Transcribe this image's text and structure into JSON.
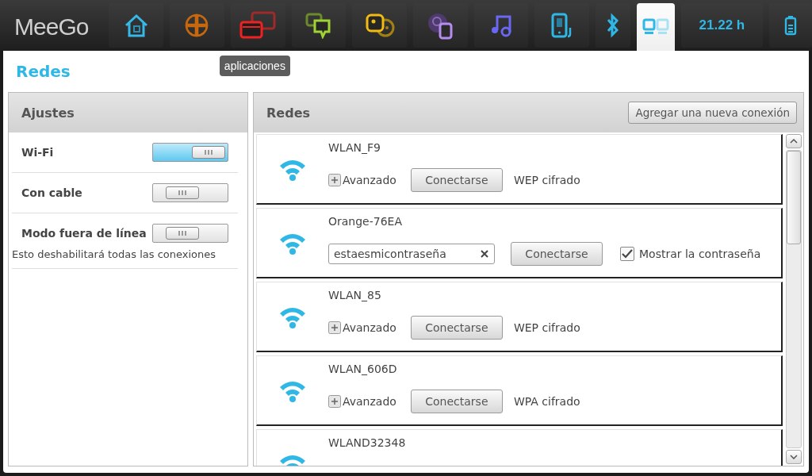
{
  "top_bar": {
    "logo": "MeeGo",
    "tabs": [
      {
        "kind": "home",
        "selected": false
      },
      {
        "kind": "grid",
        "selected": false
      },
      {
        "kind": "apps",
        "selected": false,
        "tooltip": "aplicaciones"
      },
      {
        "kind": "chat",
        "selected": false
      },
      {
        "kind": "people",
        "selected": false
      },
      {
        "kind": "media",
        "selected": false
      },
      {
        "kind": "music",
        "selected": false
      },
      {
        "kind": "device",
        "selected": false
      },
      {
        "kind": "bluetooth",
        "selected": false
      },
      {
        "kind": "network",
        "selected": true
      },
      {
        "kind": "clock",
        "label": "21.22 h",
        "selected": false
      },
      {
        "kind": "battery",
        "selected": false
      }
    ]
  },
  "page_title": "Redes",
  "settings": {
    "title": "Ajustes",
    "items": [
      {
        "label": "Wi-Fi",
        "on": true
      },
      {
        "label": "Con cable",
        "on": false
      },
      {
        "label": "Modo fuera de línea",
        "on": false,
        "note": "Esto deshabilitará todas las conexiones"
      }
    ]
  },
  "networks": {
    "title": "Redes",
    "add_button": "Agregar una nueva conexión",
    "items": [
      {
        "kind": "basic",
        "name": "WLAN_F9",
        "advanced": "Avanzado",
        "button": "Conectarse",
        "security": "WEP cifrado"
      },
      {
        "kind": "password",
        "name": "Orange-76EA",
        "password": "estaesmicontraseña",
        "button": "Conectarse",
        "show_password_label": "Mostrar la contraseña",
        "show_password": true
      },
      {
        "kind": "basic",
        "name": "WLAN_85",
        "advanced": "Avanzado",
        "button": "Conectarse",
        "security": "WEP cifrado"
      },
      {
        "kind": "basic",
        "name": "WLAN_606D",
        "advanced": "Avanzado",
        "button": "Conectarse",
        "security": "WPA cifrado"
      },
      {
        "kind": "cut",
        "name": "WLAND32348"
      }
    ]
  }
}
